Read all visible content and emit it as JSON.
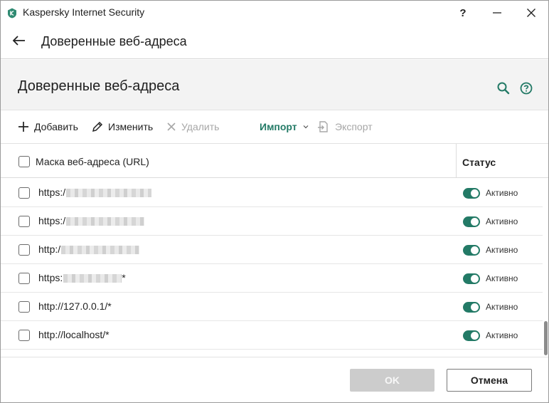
{
  "window": {
    "title": "Kaspersky Internet Security",
    "help_glyph": "?"
  },
  "header": {
    "title": "Доверенные веб-адреса"
  },
  "section": {
    "title": "Доверенные веб-адреса"
  },
  "toolbar": {
    "add_label": "Добавить",
    "edit_label": "Изменить",
    "delete_label": "Удалить",
    "import_label": "Импорт",
    "export_label": "Экспорт"
  },
  "table": {
    "columns": {
      "url": "Маска веб-адреса (URL)",
      "status": "Статус"
    },
    "rows": [
      {
        "prefix": "https:/",
        "suffix": "",
        "status": "Активно",
        "active": true
      },
      {
        "prefix": "https:/",
        "suffix": "",
        "status": "Активно",
        "active": true
      },
      {
        "prefix": "http:/",
        "suffix": "",
        "status": "Активно",
        "active": true
      },
      {
        "prefix": "https:",
        "suffix": "*",
        "status": "Активно",
        "active": true
      },
      {
        "prefix": "http://127.0.0.1/*",
        "suffix": "",
        "status": "Активно",
        "active": true
      },
      {
        "prefix": "http://localhost/*",
        "suffix": "",
        "status": "Активно",
        "active": true
      }
    ]
  },
  "footer": {
    "ok_label": "OK",
    "cancel_label": "Отмена"
  },
  "colors": {
    "accent": "#237a66",
    "toggle_on": "#237a66",
    "disabled_text": "#a7a7a7",
    "ok_disabled_bg": "#cccccc"
  },
  "icons": {
    "app": "kaspersky-shield-icon",
    "back": "arrow-left-icon",
    "search": "search-icon",
    "help": "help-circle-icon",
    "add": "plus-icon",
    "edit": "pencil-icon",
    "delete": "close-x-icon",
    "import_menu": "chevron-down-icon",
    "export": "export-icon"
  }
}
